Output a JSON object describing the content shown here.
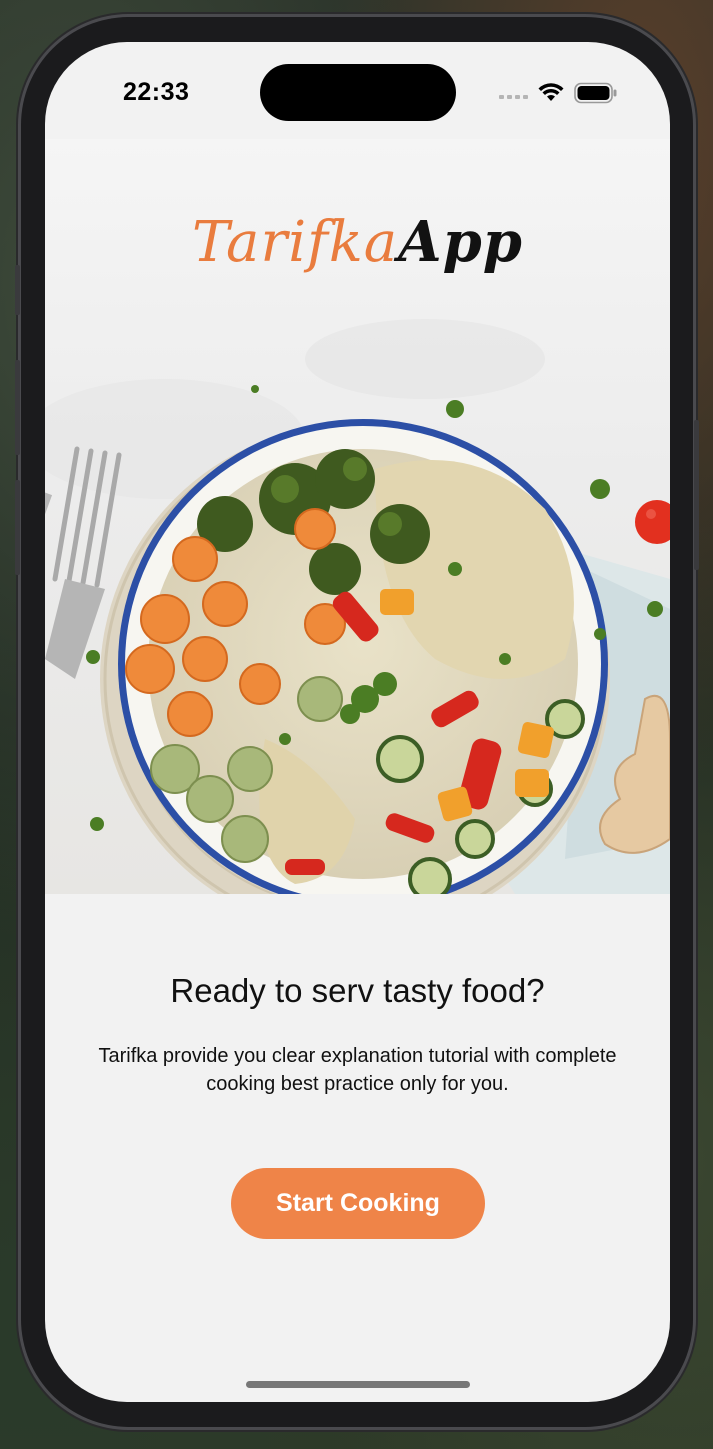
{
  "status_bar": {
    "time": "22:33",
    "wifi_icon": "wifi-icon",
    "battery_icon": "battery-icon",
    "signal_icon": "cellular-signal-icon"
  },
  "logo": {
    "part1": "Tarifka",
    "part2": "App",
    "part1_color": "#e97c3e",
    "part2_color": "#121212"
  },
  "hero": {
    "image": "food-bowl-image"
  },
  "content": {
    "headline": "Ready to serv tasty food?",
    "description": "Tarifka provide you clear explanation tutorial with complete cooking best practice only for you."
  },
  "cta": {
    "label": "Start Cooking",
    "color": "#ef8448"
  }
}
